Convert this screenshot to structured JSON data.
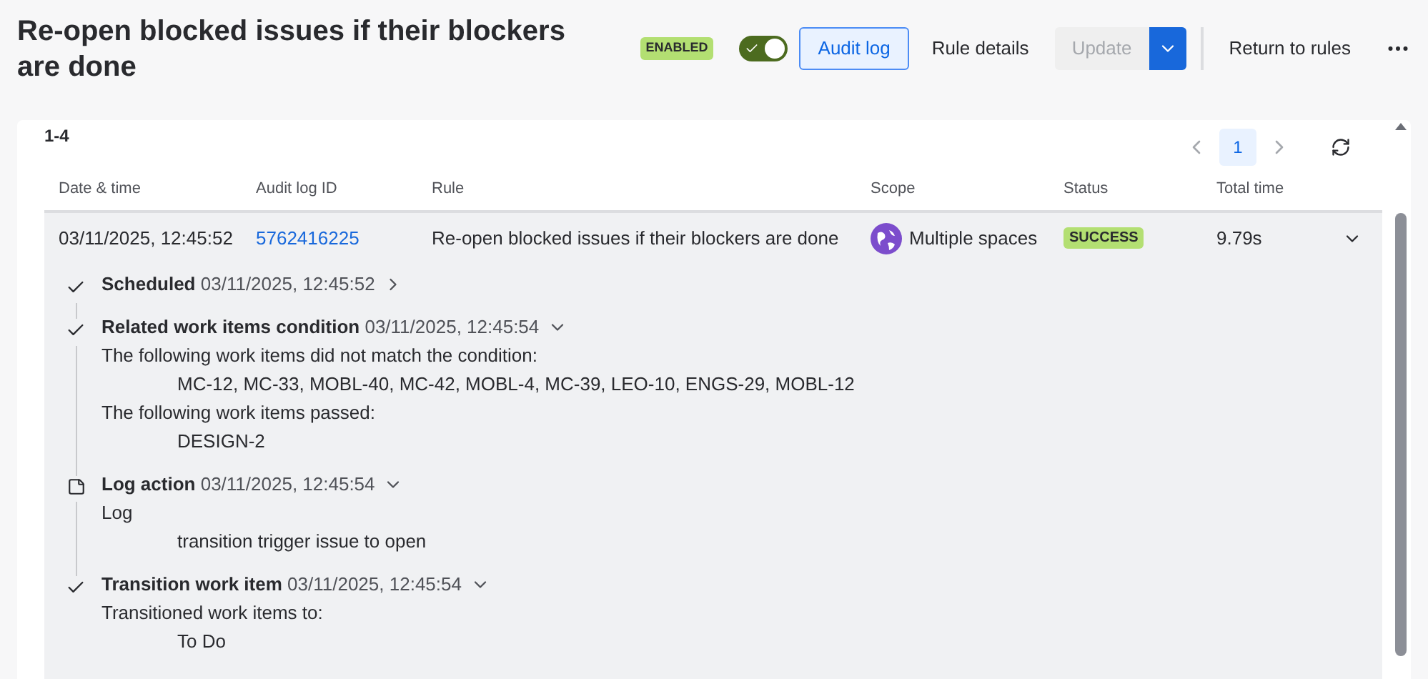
{
  "title": "Re-open blocked issues if their blockers are done",
  "status_badge": "ENABLED",
  "toggle": {
    "on": true
  },
  "buttons": [
    {
      "label": "Audit log",
      "kind": "selected"
    },
    {
      "label": "Rule details",
      "kind": "subtle"
    },
    {
      "label": "Update",
      "kind": "disabled"
    },
    {
      "label": "Return to rules",
      "kind": "subtle"
    }
  ],
  "range": "1-4",
  "pagination": {
    "pages": [
      {
        "label": "1",
        "selected": true
      }
    ]
  },
  "table": {
    "columns": [
      "Date & time",
      "Audit log ID",
      "Rule",
      "Scope",
      "Status",
      "Total time"
    ],
    "rows": [
      {
        "date": "03/11/2025, 12:45:52",
        "id": "5762416225",
        "rule": "Re-open blocked issues if their blockers are done",
        "scope": "Multiple spaces",
        "status": "SUCCESS",
        "total_time": "9.79s",
        "expanded": true,
        "steps": [
          {
            "kind": "check",
            "name": "Scheduled",
            "time": "03/11/2025, 12:45:52",
            "expanded": false
          },
          {
            "kind": "check",
            "name": "Related work items condition",
            "time": "03/11/2025, 12:45:54",
            "expanded": true,
            "lines": [
              {
                "kind": "label",
                "text": "The following work items did not match the condition:"
              },
              {
                "kind": "value",
                "text": "MC-12, MC-33, MOBL-40, MC-42, MOBL-4, MC-39, LEO-10, ENGS-29, MOBL-12"
              },
              {
                "kind": "label",
                "text": "The following work items passed:"
              },
              {
                "kind": "value",
                "text": "DESIGN-2"
              }
            ]
          },
          {
            "kind": "log",
            "name": "Log action",
            "time": "03/11/2025, 12:45:54",
            "expanded": true,
            "lines": [
              {
                "kind": "label",
                "text": "Log"
              },
              {
                "kind": "value",
                "text": "transition trigger issue to open"
              }
            ]
          },
          {
            "kind": "check",
            "name": "Transition work item",
            "time": "03/11/2025, 12:45:54",
            "expanded": true,
            "lines": [
              {
                "kind": "label",
                "text": "Transitioned work items to:"
              },
              {
                "kind": "value",
                "text": "To Do"
              }
            ]
          }
        ]
      }
    ]
  }
}
